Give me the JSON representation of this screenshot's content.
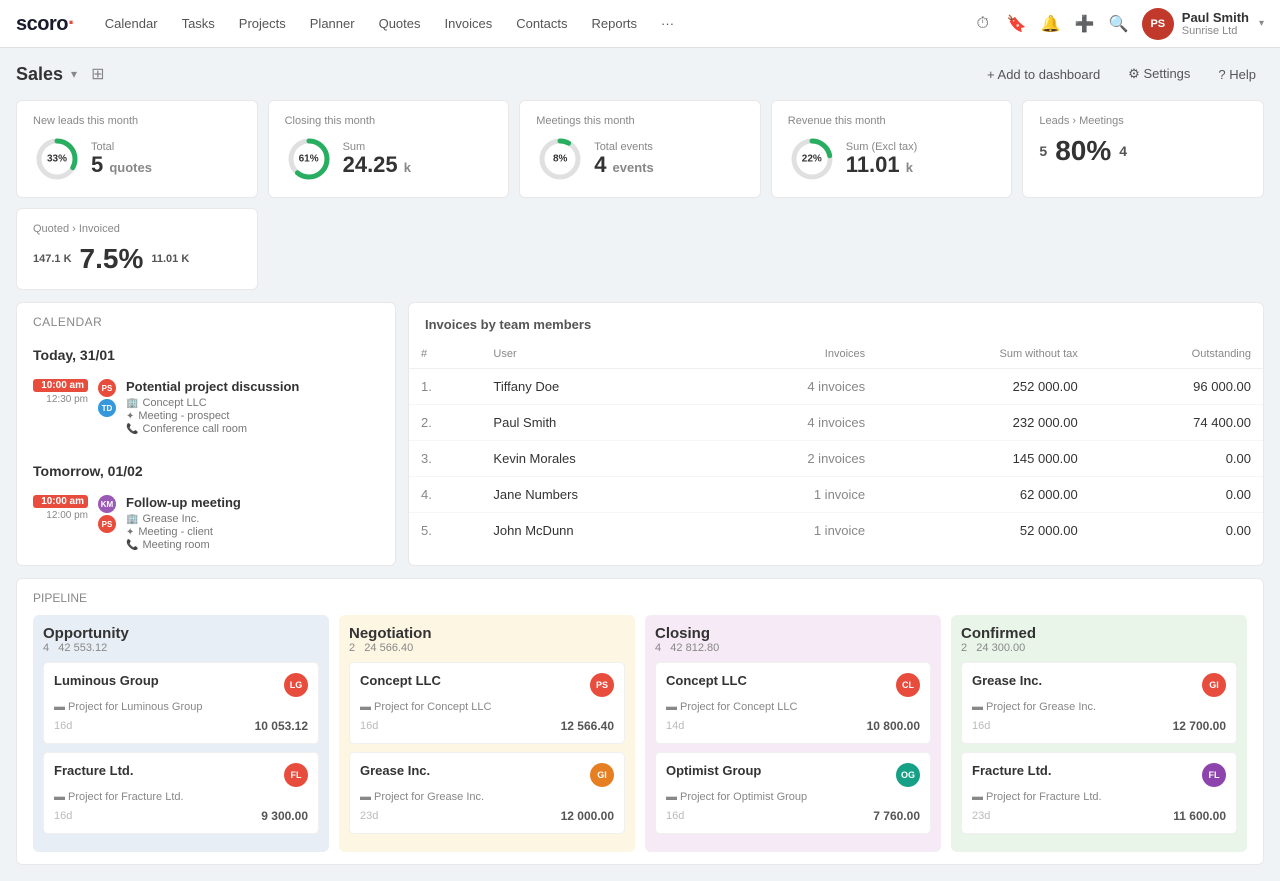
{
  "app": {
    "logo": "scoro",
    "logo_dot": "·"
  },
  "nav": {
    "items": [
      "Calendar",
      "Tasks",
      "Projects",
      "Planner",
      "Quotes",
      "Invoices",
      "Contacts",
      "Reports",
      "···"
    ],
    "icons": [
      "clock",
      "bookmark",
      "bell",
      "plus",
      "search"
    ],
    "user": {
      "name": "Paul Smith",
      "company": "Sunrise Ltd",
      "avatar_initials": "PS"
    }
  },
  "page": {
    "title": "Sales",
    "actions": {
      "add_dashboard": "+ Add to dashboard",
      "settings": "⚙ Settings",
      "help": "? Help"
    }
  },
  "kpis": [
    {
      "label": "New leads this month",
      "pct": 33,
      "sub": "Total",
      "value": "5",
      "unit": "quotes",
      "color_fill": "#27ae60",
      "color_track": "#e0e0e0",
      "show_donut": true
    },
    {
      "label": "Closing this month",
      "pct": 61,
      "sub": "Sum",
      "value": "24.25",
      "unit": "k",
      "color_fill": "#27ae60",
      "color_track": "#e0e0e0",
      "show_donut": true
    },
    {
      "label": "Meetings this month",
      "pct": 8,
      "sub": "Total events",
      "value": "4",
      "unit": "events",
      "color_fill": "#27ae60",
      "color_track": "#e0e0e0",
      "show_donut": true
    },
    {
      "label": "Revenue this month",
      "pct": 22,
      "sub": "Sum (Excl tax)",
      "value": "11.01",
      "unit": "k",
      "color_fill": "#27ae60",
      "color_track": "#e0e0e0",
      "show_donut": true
    },
    {
      "label": "Leads › Meetings",
      "left_num": "5",
      "big_pct": "80%",
      "right_num": "4",
      "show_donut": false
    },
    {
      "label": "Quoted › Invoiced",
      "left_num": "147.1 K",
      "big_pct": "7.5%",
      "right_num": "11.01 K",
      "show_donut": false
    }
  ],
  "calendar": {
    "section_label": "Calendar",
    "days": [
      {
        "label": "Today, 31/01",
        "events": [
          {
            "time_start": "10:00 am",
            "time_end": "12:30 pm",
            "avatars": [
              "PS",
              "TD"
            ],
            "avatar_colors": [
              "#e74c3c",
              "#3498db"
            ],
            "title": "Potential project discussion",
            "meta": [
              {
                "icon": "🏢",
                "text": "Concept LLC"
              },
              {
                "icon": "✦",
                "text": "Meeting - prospect"
              },
              {
                "icon": "📞",
                "text": "Conference call room"
              }
            ]
          }
        ]
      },
      {
        "label": "Tomorrow, 01/02",
        "events": [
          {
            "time_start": "10:00 am",
            "time_end": "12:00 pm",
            "avatars": [
              "KM",
              "PS"
            ],
            "avatar_colors": [
              "#9b59b6",
              "#e74c3c"
            ],
            "title": "Follow-up meeting",
            "meta": [
              {
                "icon": "🏢",
                "text": "Grease Inc."
              },
              {
                "icon": "✦",
                "text": "Meeting - client"
              },
              {
                "icon": "📞",
                "text": "Meeting room"
              }
            ]
          }
        ]
      }
    ]
  },
  "invoices_table": {
    "section_label": "Invoices by team members",
    "columns": [
      "#",
      "User",
      "Invoices",
      "Sum without tax",
      "Outstanding"
    ],
    "rows": [
      {
        "num": "1.",
        "user": "Tiffany Doe",
        "invoices": "4 invoices",
        "sum": "252 000.00",
        "outstanding": "96 000.00"
      },
      {
        "num": "2.",
        "user": "Paul Smith",
        "invoices": "4 invoices",
        "sum": "232 000.00",
        "outstanding": "74 400.00"
      },
      {
        "num": "3.",
        "user": "Kevin Morales",
        "invoices": "2 invoices",
        "sum": "145 000.00",
        "outstanding": "0.00"
      },
      {
        "num": "4.",
        "user": "Jane Numbers",
        "invoices": "1 invoice",
        "sum": "62 000.00",
        "outstanding": "0.00"
      },
      {
        "num": "5.",
        "user": "John McDunn",
        "invoices": "1 invoice",
        "sum": "52 000.00",
        "outstanding": "0.00"
      }
    ]
  },
  "pipeline": {
    "section_label": "Pipeline",
    "columns": [
      {
        "title": "Opportunity",
        "count": "4",
        "total": "42 553.12",
        "type": "opportunity",
        "cards": [
          {
            "name": "Luminous Group",
            "project": "Project for Luminous Group",
            "days": "16d",
            "amount": "10 053.12",
            "avatar": "LG",
            "avatar_color": "#e74c3c"
          },
          {
            "name": "Fracture Ltd.",
            "project": "Project for Fracture Ltd.",
            "days": "16d",
            "amount": "9 300.00",
            "avatar": "FL",
            "avatar_color": "#e74c3c"
          }
        ]
      },
      {
        "title": "Negotiation",
        "count": "2",
        "total": "24 566.40",
        "type": "negotiation",
        "cards": [
          {
            "name": "Concept LLC",
            "project": "Project for Concept LLC",
            "days": "16d",
            "amount": "12 566.40",
            "avatar": "PS",
            "avatar_color": "#e74c3c"
          },
          {
            "name": "Grease Inc.",
            "project": "Project for Grease Inc.",
            "days": "23d",
            "amount": "12 000.00",
            "avatar": "GI",
            "avatar_color": "#e67e22"
          }
        ]
      },
      {
        "title": "Closing",
        "count": "4",
        "total": "42 812.80",
        "type": "closing",
        "cards": [
          {
            "name": "Concept LLC",
            "project": "Project for Concept LLC",
            "days": "14d",
            "amount": "10 800.00",
            "avatar": "CL",
            "avatar_color": "#e74c3c"
          },
          {
            "name": "Optimist Group",
            "project": "Project for Optimist Group",
            "days": "16d",
            "amount": "7 760.00",
            "avatar": "OG",
            "avatar_color": "#16a085"
          }
        ]
      },
      {
        "title": "Confirmed",
        "count": "2",
        "total": "24 300.00",
        "type": "confirmed",
        "cards": [
          {
            "name": "Grease Inc.",
            "project": "Project for Grease Inc.",
            "days": "16d",
            "amount": "12 700.00",
            "avatar": "GI",
            "avatar_color": "#e74c3c"
          },
          {
            "name": "Fracture Ltd.",
            "project": "Project for Fracture Ltd.",
            "days": "23d",
            "amount": "11 600.00",
            "avatar": "FL",
            "avatar_color": "#8e44ad"
          }
        ]
      }
    ]
  }
}
